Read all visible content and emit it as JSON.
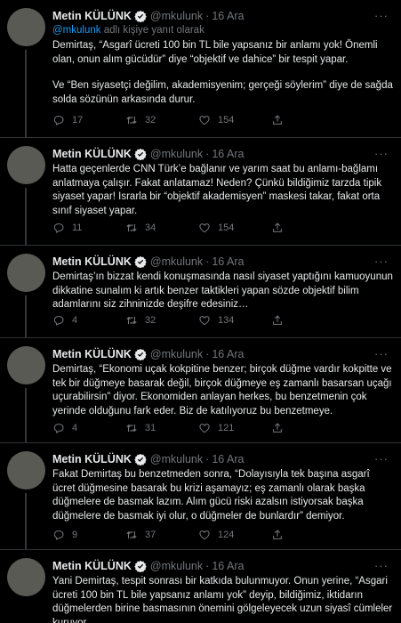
{
  "author": {
    "name": "Metin KÜLÜNK",
    "handle": "@mkulunk",
    "separator": "·"
  },
  "colors": {
    "background": "#000000",
    "text": "#e7e9ea",
    "muted": "#71767b",
    "link": "#1d9bf0",
    "border": "#2f3336"
  },
  "icons": [
    "verified-badge-icon",
    "more-icon",
    "reply-icon",
    "retweet-icon",
    "like-icon",
    "share-icon"
  ],
  "tweets": [
    {
      "date": "16 Ara",
      "reply_link": "@mkulunk",
      "reply_rest": " adlı kişiye yanıt olarak",
      "paragraphs": [
        "Demirtaş, “Asgarî ücreti 100 bin TL bile yapsanız bir anlamı yok! Önemli olan, onun alım gücüdür” diye “objektif ve dahice” bir tespit yapar.",
        "Ve “Ben siyasetçi değilim, akademisyenim; gerçeği söylerim” diye de sağda solda sözünün arkasında durur."
      ],
      "replies": "17",
      "retweets": "32",
      "likes": "154"
    },
    {
      "date": "16 Ara",
      "paragraphs": [
        "Hatta geçenlerde CNN Türk’e bağlanır ve yarım saat bu anlamı-bağlamı anlatmaya çalışır. Fakat anlatamaz! Neden? Çünkü bildiğimiz tarzda tipik siyaset yapar! Israrla bir “objektif akademisyen” maskesi takar, fakat orta sınıf siyaset yapar."
      ],
      "replies": "11",
      "retweets": "34",
      "likes": "154"
    },
    {
      "date": "16 Ara",
      "paragraphs": [
        "Demirtaş’ın bizzat kendi konuşmasında nasıl siyaset yaptığını kamuoyunun dikkatine sunalım ki artık benzer taktikleri yapan sözde objektif bilim adamlarını siz zihninizde deşifre edesiniz…"
      ],
      "replies": "4",
      "retweets": "32",
      "likes": "134"
    },
    {
      "date": "16 Ara",
      "paragraphs": [
        "Demirtaş, “Ekonomi uçak kokpitine benzer; birçok düğme vardır kokpitte ve tek bir düğmeye basarak değil, birçok düğmeye eş zamanlı basarsan uçağı uçurabilirsin” diyor. Ekonomiden anlayan herkes, bu benzetmenin çok yerinde olduğunu fark eder. Biz de katılıyoruz bu benzetmeye."
      ],
      "replies": "4",
      "retweets": "31",
      "likes": "121"
    },
    {
      "date": "16 Ara",
      "paragraphs": [
        "Fakat Demirtaş bu benzetmeden sonra, “Dolayısıyla tek başına asgarî ücret düğmesine basarak bu krizi aşamayız; eş zamanlı olarak başka düğmelere de basmak lazım. Alım gücü riski azalsın istiyorsak başka düğmelere de basmak iyi olur, o düğmeler de bunlardır” demiyor."
      ],
      "replies": "9",
      "retweets": "37",
      "likes": "124"
    },
    {
      "date": "16 Ara",
      "paragraphs": [
        "Yani Demirtaş, tespit sonrası bir katkıda bulunmuyor. Onun yerine, “Asgari ücreti 100 bin TL bile yapsanız anlamı yok” deyip, bildiğimiz, iktidarın düğmelerden birine basmasının önemini gölgeleyecek uzun siyasî cümleler kuruyor."
      ]
    }
  ]
}
